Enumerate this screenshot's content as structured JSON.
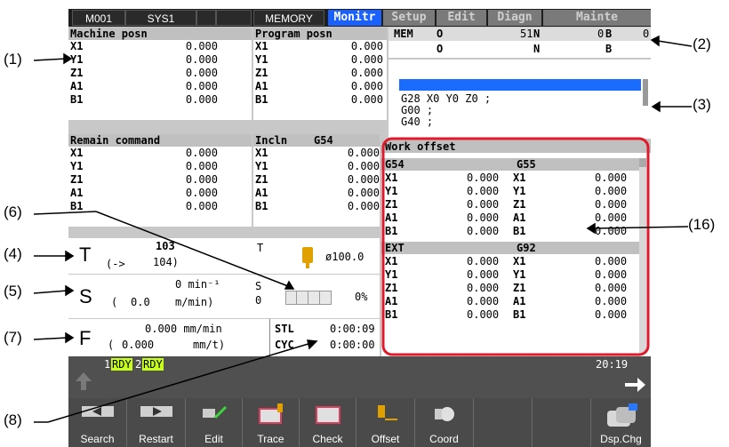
{
  "callouts": [
    "(1)",
    "(2)",
    "(3)",
    "(4)",
    "(5)",
    "(6)",
    "(7)",
    "(8)",
    "(16)"
  ],
  "topbar": {
    "cells": [
      "M001",
      "SYS1",
      "",
      "",
      "MEMORY"
    ],
    "tabs": [
      {
        "label": "Monitr",
        "active": true
      },
      {
        "label": "Setup",
        "active": false
      },
      {
        "label": "Edit",
        "active": false
      },
      {
        "label": "Diagn",
        "active": false
      },
      {
        "label": "Mainte",
        "active": false
      }
    ]
  },
  "machine_posn": {
    "title": "Machine posn",
    "rows": [
      [
        "X1",
        "0.000"
      ],
      [
        "Y1",
        "0.000"
      ],
      [
        "Z1",
        "0.000"
      ],
      [
        "A1",
        "0.000"
      ],
      [
        "B1",
        "0.000"
      ]
    ]
  },
  "program_posn": {
    "title": "Program posn",
    "rows": [
      [
        "X1",
        "0.000"
      ],
      [
        "Y1",
        "0.000"
      ],
      [
        "Z1",
        "0.000"
      ],
      [
        "A1",
        "0.000"
      ],
      [
        "B1",
        "0.000"
      ]
    ]
  },
  "remain_command": {
    "title": "Remain command",
    "rows": [
      [
        "X1",
        "0.000"
      ],
      [
        "Y1",
        "0.000"
      ],
      [
        "Z1",
        "0.000"
      ],
      [
        "A1",
        "0.000"
      ],
      [
        "B1",
        "0.000"
      ]
    ]
  },
  "incln": {
    "title": "Incln",
    "coord": "G54",
    "rows": [
      [
        "X1",
        "0.000"
      ],
      [
        "Y1",
        "0.000"
      ],
      [
        "Z1",
        "0.000"
      ],
      [
        "A1",
        "0.000"
      ],
      [
        "B1",
        "0.000"
      ]
    ]
  },
  "program_info": {
    "mem": "MEM",
    "o_label": "O",
    "o_value": "51",
    "n_label": "N",
    "n_value": "0",
    "b_label": "B",
    "b_value": "0",
    "o2_label": "O",
    "n2_label": "N",
    "b2_label": "B"
  },
  "program_lines": [
    "G28 X0 Y0 Z0 ;",
    "G00 ;",
    "G40 ;"
  ],
  "tool": {
    "letter": "T",
    "current": "103",
    "next_prefix": "(->",
    "next": "104)",
    "small_label": "T",
    "diameter": "ø100.0"
  },
  "spindle": {
    "letter": "S",
    "speed": "0 min⁻¹",
    "surface_open": "(",
    "surface_value": "0.0",
    "surface_unit": "m/min)",
    "small_label": "S",
    "small_value": "0",
    "load": "0%"
  },
  "feed": {
    "letter": "F",
    "rate": "0.000 mm/min",
    "per_rev_open": "(",
    "per_rev_value": "0.000",
    "per_rev_unit": "mm/t)",
    "stl_label": "STL",
    "stl_value": "0:00:09",
    "cyc_label": "CYC",
    "cyc_value": "0:00:00"
  },
  "work_offset": {
    "title": "Work offset",
    "sections": [
      {
        "left": "G54",
        "right": "G55",
        "rows": [
          [
            "X1",
            "0.000",
            "X1",
            "0.000"
          ],
          [
            "Y1",
            "0.000",
            "Y1",
            "0.000"
          ],
          [
            "Z1",
            "0.000",
            "Z1",
            "0.000"
          ],
          [
            "A1",
            "0.000",
            "A1",
            "0.000"
          ],
          [
            "B1",
            "0.000",
            "B1",
            "0.000"
          ]
        ]
      },
      {
        "left": "EXT",
        "right": "G92",
        "rows": [
          [
            "X1",
            "0.000",
            "X1",
            "0.000"
          ],
          [
            "Y1",
            "0.000",
            "Y1",
            "0.000"
          ],
          [
            "Z1",
            "0.000",
            "Z1",
            "0.000"
          ],
          [
            "A1",
            "0.000",
            "A1",
            "0.000"
          ],
          [
            "B1",
            "0.000",
            "B1",
            "0.000"
          ]
        ]
      }
    ]
  },
  "status": {
    "rdy1_num": "1",
    "rdy1": "RDY",
    "rdy2_num": "2",
    "rdy2": "RDY",
    "time": "20:19"
  },
  "fkeys": [
    "Search",
    "Restart",
    "Edit",
    "Trace",
    "Check",
    "Offset",
    "Coord",
    "",
    "",
    "Dsp.Chg"
  ]
}
